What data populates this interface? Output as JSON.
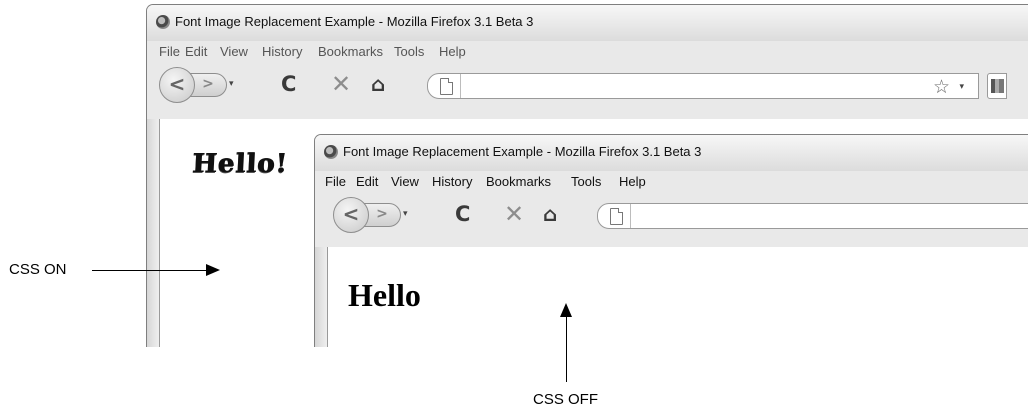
{
  "back_window": {
    "title": "Font Image Replacement Example - Mozilla Firefox 3.1 Beta 3",
    "menu": [
      "File",
      "Edit",
      "View",
      "History",
      "Bookmarks",
      "Tools",
      "Help"
    ],
    "content_text": "Hello!",
    "icons": [
      "firefox-icon",
      "back-arrow-icon",
      "forward-arrow-icon",
      "reload-icon",
      "stop-icon",
      "home-icon",
      "page-icon",
      "bookmark-star-icon",
      "search-engine-icon"
    ]
  },
  "front_window": {
    "title": "Font Image Replacement Example - Mozilla Firefox 3.1 Beta 3",
    "menu": [
      "File",
      "Edit",
      "View",
      "History",
      "Bookmarks",
      "Tools",
      "Help"
    ],
    "content_text": "Hello",
    "icons": [
      "firefox-icon",
      "back-arrow-icon",
      "forward-arrow-icon",
      "reload-icon",
      "stop-icon",
      "home-icon",
      "page-icon"
    ]
  },
  "glyphs": {
    "back": "<",
    "forward": ">",
    "dropdown": "▾",
    "reload": "C",
    "stop": "✕",
    "home": "⌂",
    "star": "☆"
  },
  "callouts": {
    "css_on": "CSS ON",
    "css_off": "CSS OFF"
  }
}
